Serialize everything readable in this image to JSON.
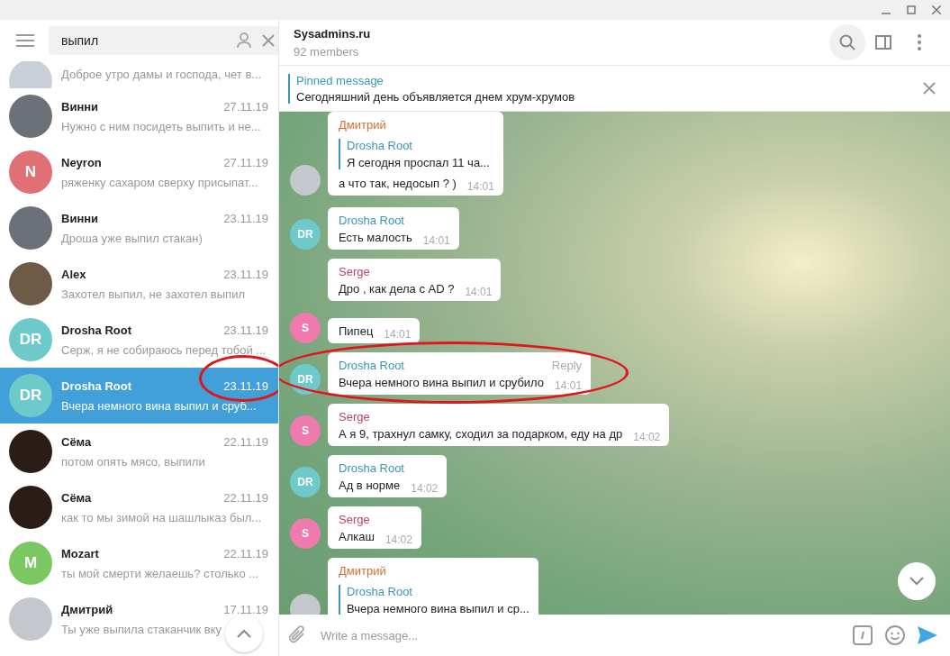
{
  "search": {
    "value": "выпил"
  },
  "chats": [
    {
      "preview": "Доброе утро дамы и господа, чет в...",
      "avatar": {
        "kind": "photo",
        "color": "#c9cfd6"
      },
      "selected": false,
      "highlighted": false
    },
    {
      "name": "Винни",
      "date": "27.11.19",
      "preview": "Нужно с ним посидеть выпить и не...",
      "avatar": {
        "kind": "photo",
        "color": "#6b7079"
      },
      "selected": false,
      "highlighted": false
    },
    {
      "name": "Neyron",
      "date": "27.11.19",
      "preview": "ряженку сахаром сверху присыпат...",
      "avatar": {
        "kind": "initials",
        "initials": "N",
        "color": "#e17076"
      },
      "selected": false,
      "highlighted": false
    },
    {
      "name": "Винни",
      "date": "23.11.19",
      "preview": "Дроша уже выпил стакан)",
      "avatar": {
        "kind": "photo",
        "color": "#6b7079"
      },
      "selected": false,
      "highlighted": false
    },
    {
      "name": "Alex",
      "date": "23.11.19",
      "preview": "Захотел выпил, не захотел выпил",
      "avatar": {
        "kind": "photo",
        "color": "#6e5a45"
      },
      "selected": false,
      "highlighted": false
    },
    {
      "name": "Drosha Root",
      "date": "23.11.19",
      "preview": "Серж, я не собираюсь перед тобой ...",
      "avatar": {
        "kind": "initials",
        "initials": "DR",
        "color": "#6ec9cb"
      },
      "selected": false,
      "highlighted": false
    },
    {
      "name": "Drosha Root",
      "date": "23.11.19",
      "preview": "Вчера немного вина выпил и сруб...",
      "avatar": {
        "kind": "initials",
        "initials": "DR",
        "color": "#6ec9cb"
      },
      "selected": true,
      "highlighted": true
    },
    {
      "name": "Сёма",
      "date": "22.11.19",
      "preview": "потом опять мясо, выпили",
      "avatar": {
        "kind": "photo",
        "color": "#2a1d16"
      },
      "selected": false,
      "highlighted": false
    },
    {
      "name": "Сёма",
      "date": "22.11.19",
      "preview": "как то мы зимой на шашлыказ был...",
      "avatar": {
        "kind": "photo",
        "color": "#2a1d16"
      },
      "selected": false,
      "highlighted": false
    },
    {
      "name": "Mozart",
      "date": "22.11.19",
      "preview": "ты мой смерти желаешь? столько ...",
      "avatar": {
        "kind": "initials",
        "initials": "M",
        "color": "#7bc862"
      },
      "selected": false,
      "highlighted": false
    },
    {
      "name": "Дмитрий",
      "date": "17.11.19",
      "preview": "Ты уже выпила стаканчик вку",
      "avatar": {
        "kind": "photo",
        "color": "#c4c8cc"
      },
      "selected": false,
      "highlighted": false
    }
  ],
  "chat": {
    "title": "Sysadmins.ru",
    "subtitle": "92 members"
  },
  "pinned": {
    "label": "Pinned message",
    "text": "Сегодняшний день объявляется днем хрум-хрумов"
  },
  "messages": [
    {
      "sender": "Дмитрий",
      "color": "#d0702c",
      "reply": {
        "name": "Drosha Root",
        "text": "Я сегодня проспал 11 ча..."
      },
      "text": "а что так, недосып ? )",
      "time": "14:01",
      "avatar": {
        "kind": "photo",
        "color": "#c4c8cc"
      },
      "highlighted": false
    },
    {
      "sender": "Drosha Root",
      "color": "#3a95b8",
      "text": "Есть малость",
      "time": "14:01",
      "avatar": {
        "kind": "initials",
        "initials": "DR",
        "color": "#6ec9cb"
      },
      "highlighted": false
    },
    {
      "sender": "Serge",
      "color": "#c0416e",
      "text": "Дро , как дела с AD  ?",
      "time": "14:01",
      "highlighted": false
    },
    {
      "text": "Пипец",
      "time": "14:01",
      "avatar": {
        "kind": "initials",
        "initials": "S",
        "color": "#ee7aae"
      },
      "highlighted": false
    },
    {
      "sender": "Drosha Root",
      "color": "#3a95b8",
      "text": "Вчера немного вина выпил и срубило",
      "time": "14:01",
      "avatar": {
        "kind": "initials",
        "initials": "DR",
        "color": "#6ec9cb"
      },
      "reply_label": "Reply",
      "highlighted": true
    },
    {
      "sender": "Serge",
      "color": "#c0416e",
      "text": "А я 9, трахнул самку, сходил за подарком, еду на др",
      "time": "14:02",
      "avatar": {
        "kind": "initials",
        "initials": "S",
        "color": "#ee7aae"
      },
      "highlighted": false
    },
    {
      "sender": "Drosha Root",
      "color": "#3a95b8",
      "text": "Ад в норме",
      "time": "14:02",
      "avatar": {
        "kind": "initials",
        "initials": "DR",
        "color": "#6ec9cb"
      },
      "highlighted": false
    },
    {
      "sender": "Serge",
      "color": "#c0416e",
      "text": "Алкаш",
      "time": "14:02",
      "avatar": {
        "kind": "initials",
        "initials": "S",
        "color": "#ee7aae"
      },
      "highlighted": false
    },
    {
      "sender": "Дмитрий",
      "color": "#d0702c",
      "reply": {
        "name": "Drosha Root",
        "text": "Вчера немного вина выпил и ср..."
      },
      "avatar": {
        "kind": "photo",
        "color": "#c4c8cc"
      },
      "highlighted": false
    }
  ],
  "composer": {
    "placeholder": "Write a message..."
  }
}
